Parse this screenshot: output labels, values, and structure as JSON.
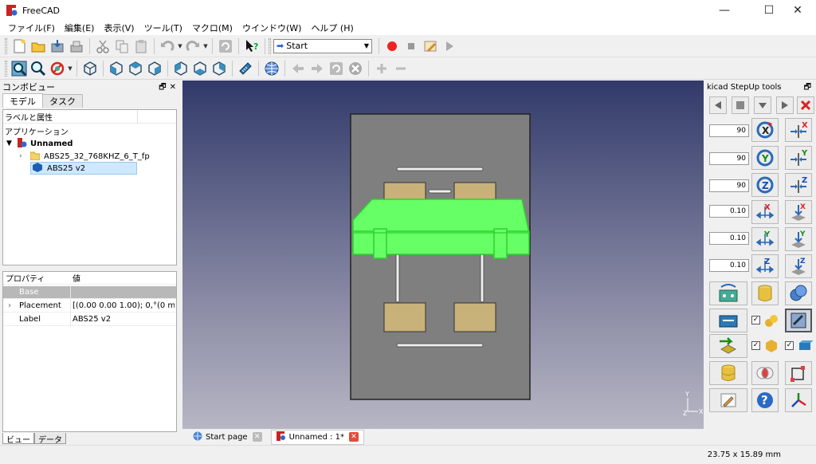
{
  "window": {
    "title": "FreeCAD",
    "minimize": "—",
    "maximize": "☐",
    "close": "✕"
  },
  "menu": [
    "ファイル(F)",
    "編集(E)",
    "表示(V)",
    "ツール(T)",
    "マクロ(M)",
    "ウインドウ(W)",
    "ヘルプ (H)"
  ],
  "toolbar": {
    "workbench": "Start"
  },
  "combo_view": {
    "title": "コンボビュー",
    "tabs": [
      "モデル",
      "タスク"
    ],
    "tree_header": "ラベルと属性",
    "tree_section": "アプリケーション",
    "document": "Unnamed",
    "items": [
      "ABS25_32_768KHZ_6_T_fp",
      "ABS25 v2"
    ]
  },
  "properties": {
    "header_property": "プロパティ",
    "header_value": "値",
    "group": "Base",
    "rows": [
      {
        "key": "Placement",
        "value": "[(0.00 0.00 1.00); 0,°(0 mm ..."
      },
      {
        "key": "Label",
        "value": "ABS25 v2"
      }
    ]
  },
  "bottom_tabs": [
    "ビュー",
    "データ"
  ],
  "doc_tabs": [
    {
      "label": "Start page"
    },
    {
      "label": "Unnamed : 1*"
    }
  ],
  "axis": {
    "x": "X",
    "y": "Y",
    "z": "Z"
  },
  "kicad": {
    "title": "kicad StepUp tools",
    "inputs": [
      "90",
      "90",
      "90",
      "0.10",
      "0.10",
      "0.10"
    ]
  },
  "status": {
    "dimensions": "23.75 x 15.89 mm"
  },
  "colors": {
    "accent_green": "#66ff66",
    "board": "#808080",
    "pad": "#c8b27a",
    "viewport_top": "#313a6a"
  }
}
